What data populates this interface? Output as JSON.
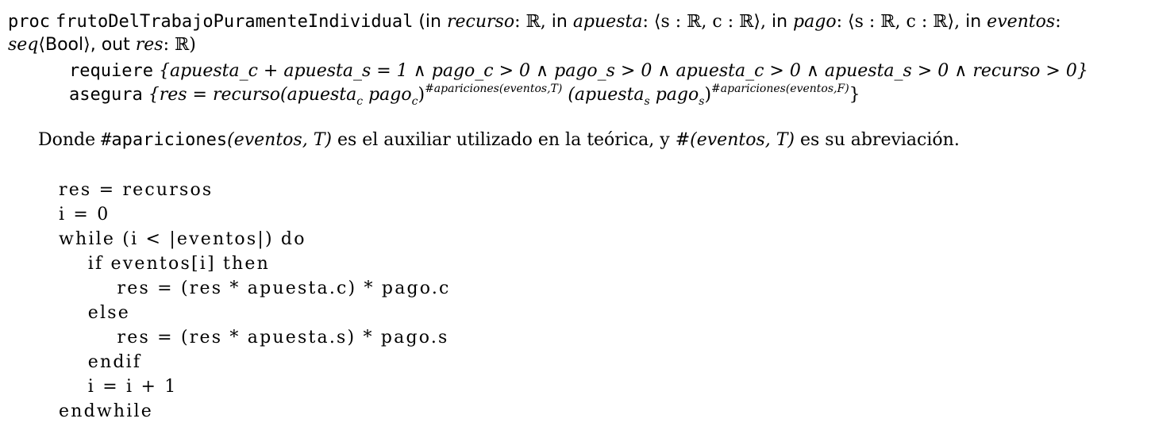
{
  "spec": {
    "signature": {
      "kw_proc": "proc",
      "name": "frutoDelTrabajoPuramenteIndividual",
      "open": "(",
      "kw_in_1": "in",
      "p1_name": "recurso",
      "p1_type": ": ℝ,",
      "kw_in_2": "in",
      "p2_name": "apuesta",
      "p2_type": ": ⟨s : ℝ, c : ℝ⟩,",
      "kw_in_3": "in",
      "p3_name": "pago",
      "p3_type": ": ⟨s : ℝ, c : ℝ⟩,",
      "kw_in_4": "in",
      "p4_name": "eventos",
      "p4_colon": ":",
      "p4_type_seq": "seq",
      "p4_type_rest": "⟨Bool⟩,",
      "kw_out": "out",
      "p5_name": "res",
      "p5_type": ": ℝ)"
    },
    "requiere": {
      "kw": "requiere",
      "text": "{apuesta_c + apuesta_s = 1 ∧ pago_c > 0 ∧ pago_s > 0 ∧ apuesta_c > 0 ∧ apuesta_s > 0 ∧ recurso > 0}"
    },
    "asegura": {
      "kw": "asegura",
      "pre": "{res = recurso(apuesta",
      "sub_c1": "c",
      "mid1": " pago",
      "sub_c2": "c",
      "close1": ")",
      "exp1": "#apariciones(eventos,T)",
      "mid2": " (apuesta",
      "sub_s1": "s",
      "mid3": " pago",
      "sub_s2": "s",
      "close2": ")",
      "exp2": "#apariciones(eventos,F)",
      "end": "}"
    }
  },
  "note": {
    "pre": "Donde ",
    "fn": "#apariciones",
    "args1": "(eventos, T)",
    "mid": " es el auxiliar utilizado en la teórica, y ",
    "args2": "#(eventos, T)",
    "post": " es su abreviación."
  },
  "code": [
    "res = recursos",
    "i = 0",
    "while (i < |eventos|) do",
    "    if eventos[i] then",
    "        res = (res * apuesta.c) * pago.c",
    "    else",
    "        res = (res * apuesta.s) * pago.s",
    "    endif",
    "    i = i + 1",
    "endwhile"
  ]
}
